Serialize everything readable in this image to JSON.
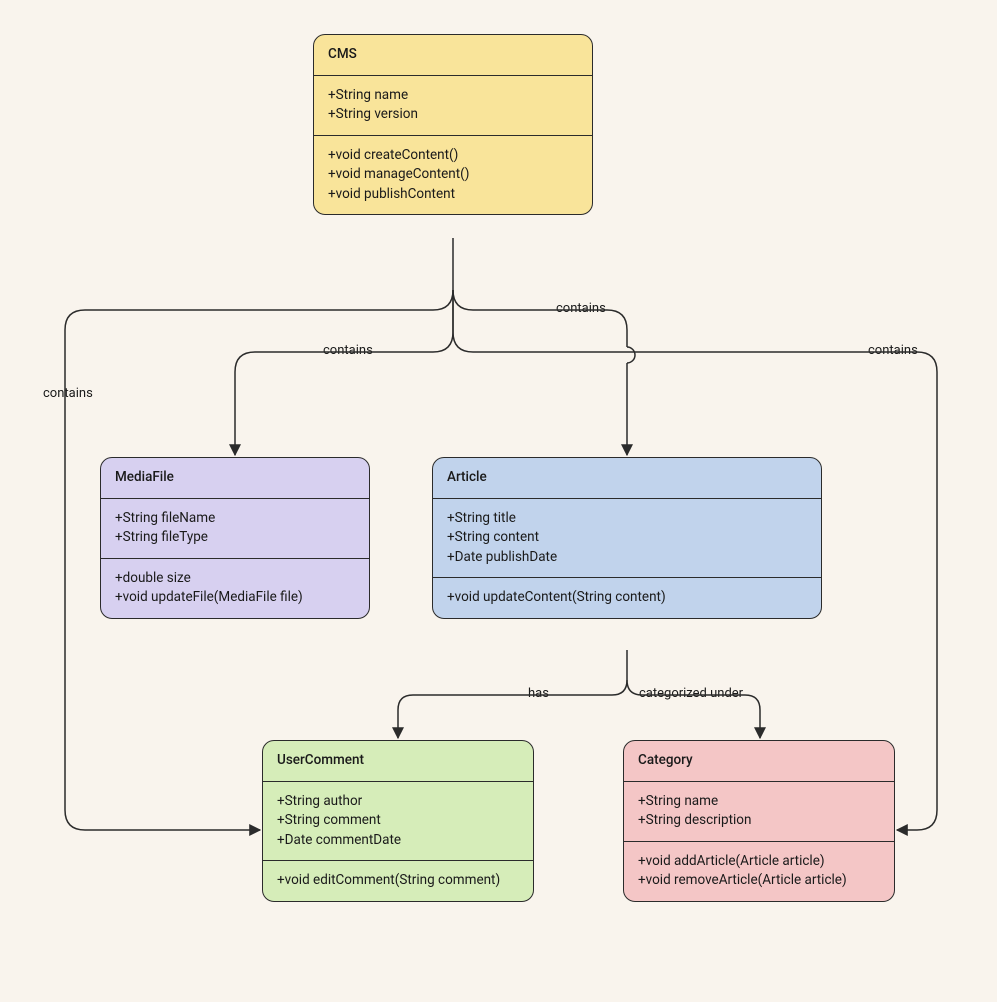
{
  "classes": {
    "cms": {
      "name": "CMS",
      "attrs": [
        "+String name",
        "+String version"
      ],
      "methods": [
        "+void createContent()",
        "+void manageContent()",
        "+void publishContent"
      ]
    },
    "mediafile": {
      "name": "MediaFile",
      "attrs": [
        "+String fileName",
        "+String fileType"
      ],
      "methods": [
        "+double size",
        "+void updateFile(MediaFile file)"
      ]
    },
    "article": {
      "name": "Article",
      "attrs": [
        "+String title",
        "+String content",
        "+Date publishDate"
      ],
      "methods": [
        "+void updateContent(String content)"
      ]
    },
    "usercomment": {
      "name": "UserComment",
      "attrs": [
        "+String author",
        "+String comment",
        "+Date commentDate"
      ],
      "methods": [
        "+void editComment(String comment)"
      ]
    },
    "category": {
      "name": "Category",
      "attrs": [
        "+String name",
        "+String description"
      ],
      "methods": [
        "+void addArticle(Article article)",
        "+void removeArticle(Article article)"
      ]
    }
  },
  "edges": {
    "cms_article": "contains",
    "cms_mediafile": "contains",
    "cms_usercomment": "contains",
    "cms_category": "contains",
    "article_usercomment": "has",
    "article_category": "categorized under"
  }
}
